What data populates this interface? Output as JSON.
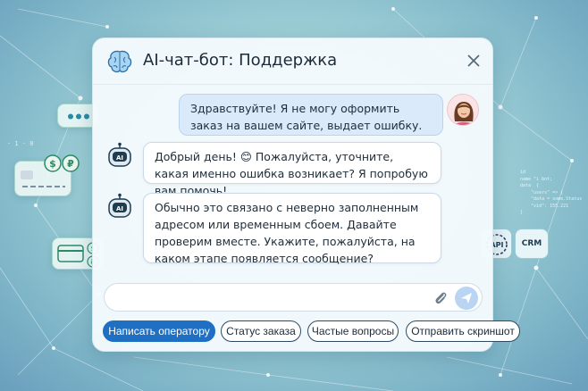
{
  "colors": {
    "accent": "#1f6fc3",
    "user_bubble": "#dbeafb",
    "window_bg": "#f4fafd"
  },
  "header": {
    "title": "AI-чат-бот: Поддержка",
    "icon": "brain-icon"
  },
  "messages": [
    {
      "from": "user",
      "text": "Здравствуйте! Я не могу оформить заказ на вашем сайте, выдает ошибку."
    },
    {
      "from": "bot",
      "avatar": "AI",
      "text": "Добрый день! 😊 Пожалуйста, уточните, какая именно ошибка возникает? Я попробую вам помочь!"
    },
    {
      "from": "bot",
      "avatar": "AI",
      "text": "Обычно это связано с неверно заполненным адресом или временным сбоем. Давайте проверим вместе. Укажите, пожалуйста, на каком этапе появляется сообщение?"
    }
  ],
  "input": {
    "value": "",
    "placeholder": ""
  },
  "quick_replies": [
    "Написать оператору",
    "Статус заказа",
    "Частые вопросы",
    "Отправить скриншот"
  ],
  "decor": {
    "binary": "· 1 · 0",
    "coin_1": "$",
    "coin_2": "₽",
    "card_coin_1": "$",
    "card_coin_2": "₽",
    "api": "API",
    "crm": "CRM",
    "code": "id\nname \"i bot;\ndata  {\n    \"users\" => {\n    \"data = some.Status\n    \"vid\": 155.221\n}"
  }
}
